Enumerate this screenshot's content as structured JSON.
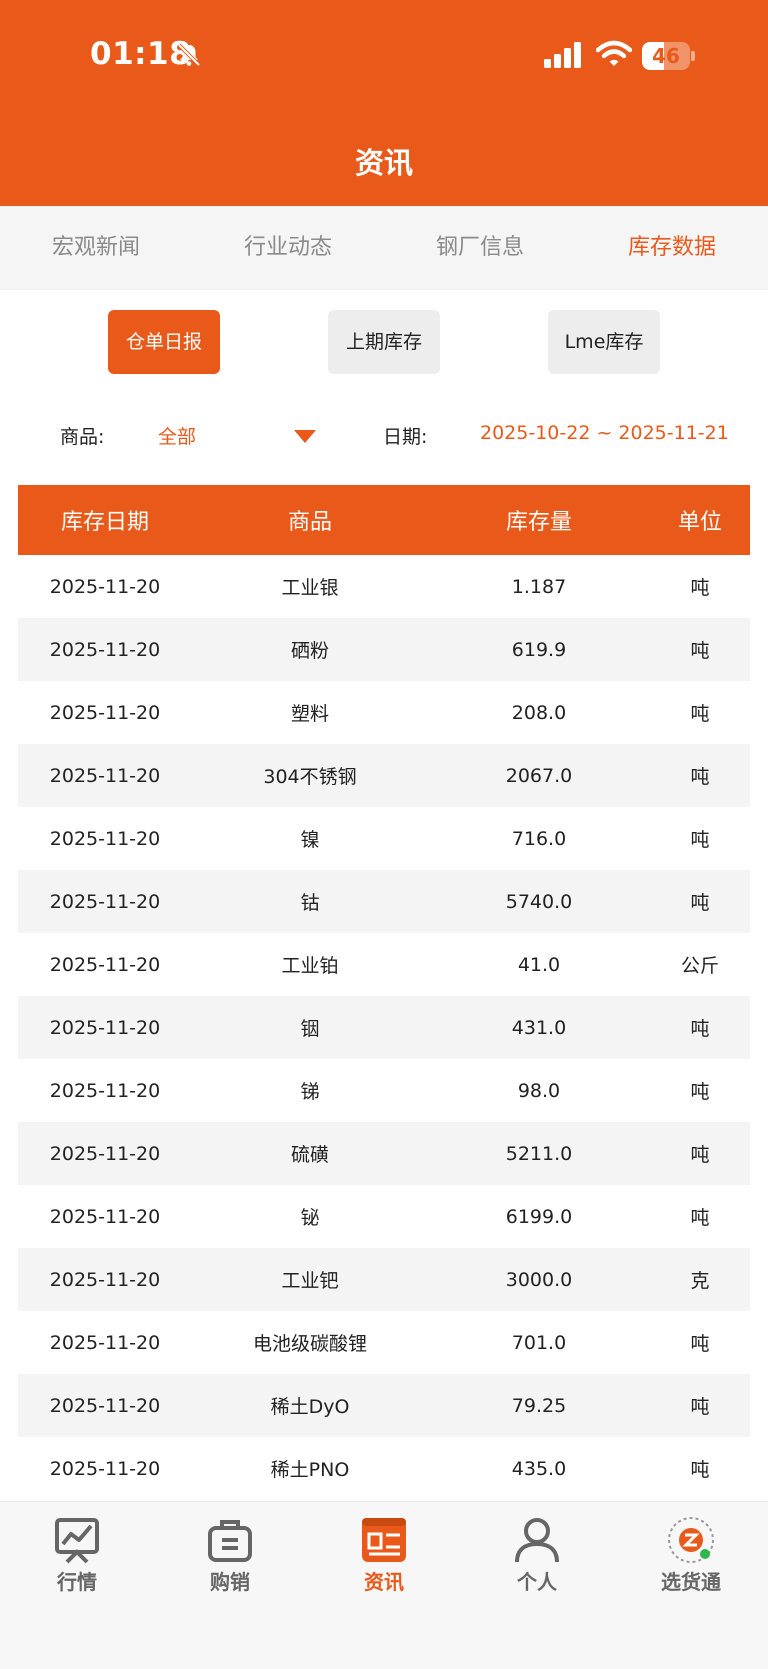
{
  "status_bar": {
    "time": "01:18",
    "battery": "46",
    "battery_level": 0.46
  },
  "header": {
    "title": "资讯"
  },
  "tabs": [
    {
      "label": "宏观新闻",
      "active": false
    },
    {
      "label": "行业动态",
      "active": false
    },
    {
      "label": "钢厂信息",
      "active": false
    },
    {
      "label": "库存数据",
      "active": true
    }
  ],
  "subtabs": [
    {
      "label": "仓单日报",
      "active": true
    },
    {
      "label": "上期库存",
      "active": false
    },
    {
      "label": "Lme库存",
      "active": false
    }
  ],
  "filters": {
    "product_label": "商品:",
    "product_value": "全部",
    "date_label": "日期:",
    "date_value": "2025-10-22 ~ 2025-11-21"
  },
  "table": {
    "headers": [
      "库存日期",
      "商品",
      "库存量",
      "单位"
    ],
    "rows": [
      [
        "2025-11-20",
        "工业银",
        "1.187",
        "吨"
      ],
      [
        "2025-11-20",
        "硒粉",
        "619.9",
        "吨"
      ],
      [
        "2025-11-20",
        "塑料",
        "208.0",
        "吨"
      ],
      [
        "2025-11-20",
        "304不锈钢",
        "2067.0",
        "吨"
      ],
      [
        "2025-11-20",
        "镍",
        "716.0",
        "吨"
      ],
      [
        "2025-11-20",
        "钴",
        "5740.0",
        "吨"
      ],
      [
        "2025-11-20",
        "工业铂",
        "41.0",
        "公斤"
      ],
      [
        "2025-11-20",
        "铟",
        "431.0",
        "吨"
      ],
      [
        "2025-11-20",
        "锑",
        "98.0",
        "吨"
      ],
      [
        "2025-11-20",
        "硫磺",
        "5211.0",
        "吨"
      ],
      [
        "2025-11-20",
        "铋",
        "6199.0",
        "吨"
      ],
      [
        "2025-11-20",
        "工业钯",
        "3000.0",
        "克"
      ],
      [
        "2025-11-20",
        "电池级碳酸锂",
        "701.0",
        "吨"
      ],
      [
        "2025-11-20",
        "稀土DyO",
        "79.25",
        "吨"
      ],
      [
        "2025-11-20",
        "稀土PNO",
        "435.0",
        "吨"
      ]
    ]
  },
  "bottom_nav": [
    {
      "label": "行情",
      "icon": "chart-icon",
      "active": false
    },
    {
      "label": "购销",
      "icon": "briefcase-icon",
      "active": false
    },
    {
      "label": "资讯",
      "icon": "news-icon",
      "active": true
    },
    {
      "label": "个人",
      "icon": "person-icon",
      "active": false
    },
    {
      "label": "选货通",
      "icon": "app-logo-icon",
      "active": false
    }
  ],
  "colors": {
    "accent": "#E95A1A",
    "tab_bg": "#F5F5F5",
    "row_alt": "#F4F4F4"
  }
}
